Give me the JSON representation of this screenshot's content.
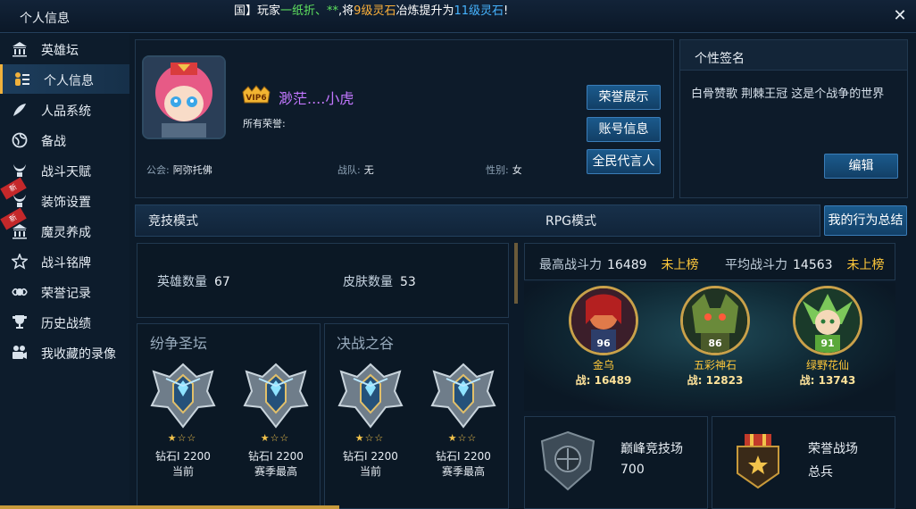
{
  "window": {
    "title": "个人信息",
    "close": "✕"
  },
  "ticker": [
    {
      "t": "国】玩家",
      "c": ""
    },
    {
      "t": "一纸折、**",
      "c": "g"
    },
    {
      "t": ",将",
      "c": ""
    },
    {
      "t": "9级灵石",
      "c": "o"
    },
    {
      "t": "冶炼提升为",
      "c": ""
    },
    {
      "t": "11级灵石",
      "c": "b"
    },
    {
      "t": "!",
      "c": ""
    }
  ],
  "sidebar": {
    "items": [
      {
        "label": "英雄坛",
        "icon": "temple-icon"
      },
      {
        "label": "个人信息",
        "icon": "profile-list-icon",
        "active": true
      },
      {
        "label": "人品系统",
        "icon": "feather-icon"
      },
      {
        "label": "备战",
        "icon": "globe-icon"
      },
      {
        "label": "战斗天赋",
        "icon": "horns-icon"
      },
      {
        "label": "装饰设置",
        "icon": "horns-icon",
        "badge": "新"
      },
      {
        "label": "魔灵养成",
        "icon": "temple-icon",
        "badge": "新"
      },
      {
        "label": "战斗铭牌",
        "icon": "star-badge-icon"
      },
      {
        "label": "荣誉记录",
        "icon": "emblem-icon"
      },
      {
        "label": "历史战绩",
        "icon": "trophy-icon"
      },
      {
        "label": "我收藏的录像",
        "icon": "video-icon"
      }
    ]
  },
  "profile": {
    "vip": "VIP6",
    "name": "渺茫....小虎",
    "honors_label": "所有荣誉:",
    "guild_label": "公会:",
    "guild": "阿弥托佛",
    "team_label": "战队:",
    "team": "无",
    "gender_label": "性别:",
    "gender": "女",
    "buttons": {
      "honor": "荣誉展示",
      "account": "账号信息",
      "ambassador": "全民代言人"
    }
  },
  "signature": {
    "title": "个性签名",
    "text": "白骨赞歌  荆棘王冠 这是个战争的世界",
    "edit": "编辑"
  },
  "tabs": {
    "arena": "竞技模式",
    "rpg": "RPG模式",
    "summary": "我的行为总结"
  },
  "stats": {
    "hero_label": "英雄数量",
    "hero_count": "67",
    "skin_label": "皮肤数量",
    "skin_count": "53"
  },
  "arenas": [
    {
      "title": "纷争圣坛",
      "ranks": [
        {
          "rank": "钻石Ⅰ 2200",
          "sub": "当前"
        },
        {
          "rank": "钻石Ⅰ 2200",
          "sub": "赛季最高"
        }
      ]
    },
    {
      "title": "决战之谷",
      "ranks": [
        {
          "rank": "钻石Ⅰ 2200",
          "sub": "当前"
        },
        {
          "rank": "钻石Ⅰ 2200",
          "sub": "赛季最高"
        }
      ]
    }
  ],
  "stars_text": "★☆☆",
  "power": {
    "max_label": "最高战斗力",
    "max_value": "16489",
    "max_rank": "未上榜",
    "avg_label": "平均战斗力",
    "avg_value": "14563",
    "avg_rank": "未上榜"
  },
  "heroes": [
    {
      "level": "96",
      "name": "金乌",
      "power": "战: 16489"
    },
    {
      "level": "86",
      "name": "五彩神石",
      "power": "战: 12823"
    },
    {
      "level": "91",
      "name": "绿野花仙",
      "power": "战: 13743"
    }
  ],
  "peak": {
    "label": "巅峰竞技场",
    "value": "700"
  },
  "honor_field": {
    "label": "荣誉战场",
    "value": "总兵"
  },
  "colors": {
    "accent": "#f0b13c",
    "button": "#1b5a8c",
    "rank_text": "#ffc83a",
    "name": "#c277ff"
  }
}
